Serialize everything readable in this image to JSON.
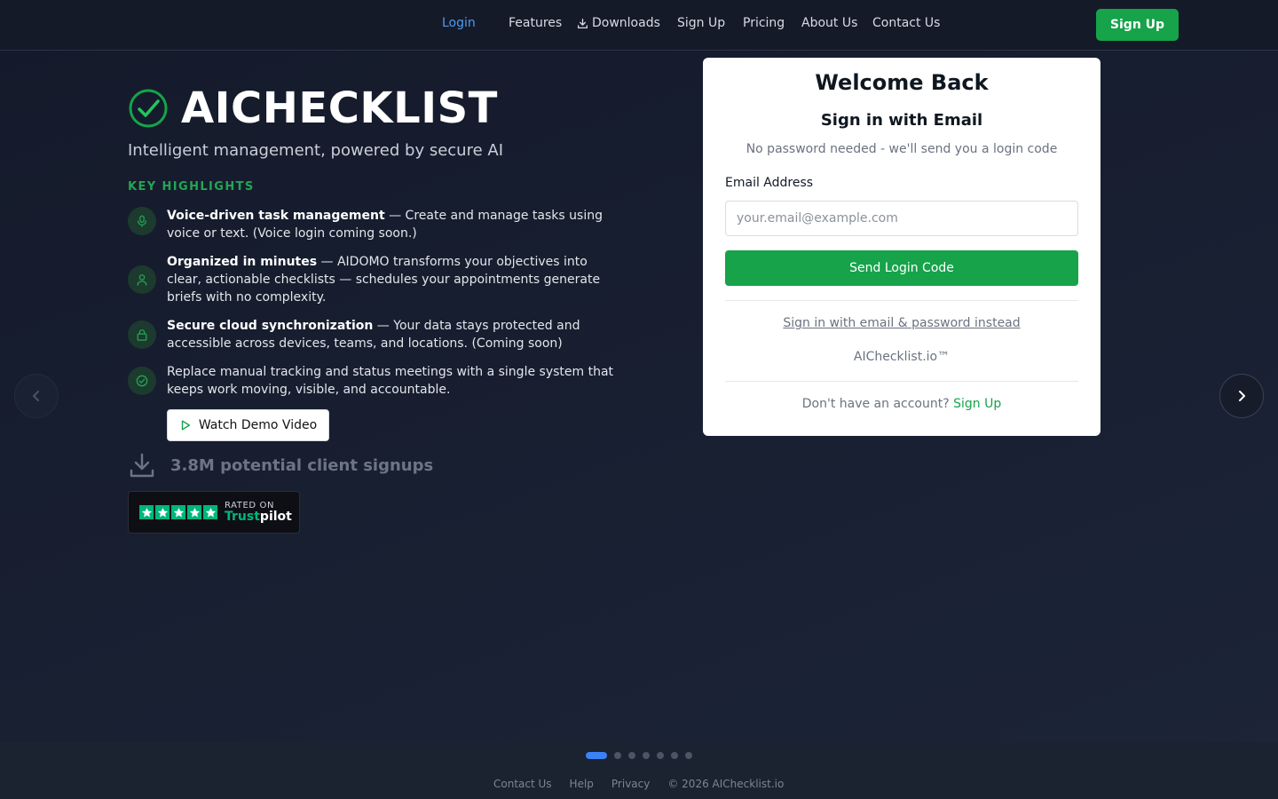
{
  "nav": {
    "items": [
      {
        "label": "Login",
        "active": true
      },
      {
        "label": "Features"
      },
      {
        "label": "Downloads",
        "icon": "download-icon"
      },
      {
        "label": "Sign Up"
      },
      {
        "label": "Pricing"
      },
      {
        "label": "About Us"
      },
      {
        "label": "Contact Us"
      }
    ],
    "cta_label": "Sign Up"
  },
  "hero": {
    "brand_title": "AICHECKLIST",
    "brand_icon": "check-circle-icon",
    "tagline": "Intelligent management, powered by secure AI",
    "highlights_heading": "KEY HIGHLIGHTS",
    "highlights": [
      {
        "icon": "microphone-icon",
        "bold": "Voice-driven task management",
        "text": " — Create and manage tasks using voice or text. (Voice login coming soon.)"
      },
      {
        "icon": "user-icon",
        "bold": "Organized in minutes",
        "text": " — AIDOMO transforms your objectives into clear, actionable checklists — schedules your appointments generate briefs with no complexity."
      },
      {
        "icon": "lock-icon",
        "bold": "Secure cloud synchronization",
        "text": " — Your data stays protected and accessible across devices, teams, and locations. (Coming soon)"
      },
      {
        "icon": "check-circle-icon",
        "bold": "",
        "text": "Replace manual tracking and status meetings with a single system that keeps work moving, visible, and accountable."
      }
    ],
    "demo_button_label": "Watch Demo Video",
    "signups_text": "3.8M potential client signups",
    "trustpilot": {
      "rated_on": "RATED ON",
      "brand_part1": "Trust",
      "brand_part2": "pilot"
    }
  },
  "login_card": {
    "title": "Welcome Back",
    "subtitle": "Sign in with Email",
    "description": "No password needed - we'll send you a login code",
    "email_label": "Email Address",
    "email_placeholder": "your.email@example.com",
    "email_value": "",
    "send_button_label": "Send Login Code",
    "alt_signin_label": "Sign in with email & password instead",
    "brand_text": "AIChecklist.io™",
    "footer_prompt": "Don't have an account? ",
    "footer_signup_label": "Sign Up"
  },
  "carousel": {
    "slide_count": 7,
    "active_index": 0
  },
  "footer": {
    "links": [
      "Contact Us",
      "Help",
      "Privacy"
    ],
    "copyright": "© 2026 AIChecklist.io"
  },
  "colors": {
    "accent_green": "#16a34a",
    "active_blue": "#3b82f6",
    "bg_dark": "#141a28"
  }
}
